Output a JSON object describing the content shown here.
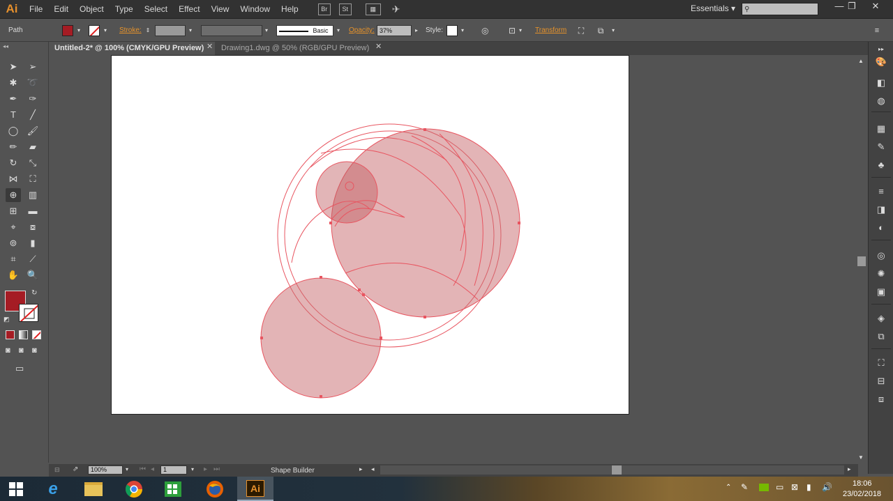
{
  "app": {
    "logo": "Ai",
    "brand_color": "#e6902c"
  },
  "menu": [
    "File",
    "Edit",
    "Object",
    "Type",
    "Select",
    "Effect",
    "View",
    "Window",
    "Help"
  ],
  "menu_boxes": {
    "bridge": "Br",
    "stock": "St"
  },
  "workspace": {
    "label": "Essentials"
  },
  "window_controls": {
    "minimize": "—",
    "restore": "❐",
    "close": "✕"
  },
  "control_bar": {
    "selection_label": "Path",
    "fill_color": "#a51c24",
    "stroke_label": "Stroke:",
    "brush_label": "Basic",
    "opacity_label": "Opacity:",
    "opacity_value": "37%",
    "style_label": "Style:",
    "transform_label": "Transform"
  },
  "tabs": [
    {
      "label": "Untitled-2* @ 100% (CMYK/GPU Preview)",
      "active": true
    },
    {
      "label": "Drawing1.dwg @ 50% (RGB/GPU Preview)",
      "active": false
    }
  ],
  "tools": [
    [
      "selection-tool-icon",
      "direct-selection-tool-icon"
    ],
    [
      "magic-wand-icon",
      "lasso-icon"
    ],
    [
      "pen-tool-icon",
      "curvature-tool-icon"
    ],
    [
      "type-tool-icon",
      "line-segment-tool-icon"
    ],
    [
      "ellipse-tool-icon",
      "paintbrush-tool-icon"
    ],
    [
      "pencil-tool-icon",
      "eraser-tool-icon"
    ],
    [
      "rotate-tool-icon",
      "scale-tool-icon"
    ],
    [
      "width-tool-icon",
      "free-transform-icon"
    ],
    [
      "shape-builder-icon",
      "perspective-grid-icon"
    ],
    [
      "mesh-tool-icon",
      "gradient-tool-icon"
    ],
    [
      "eyedropper-icon",
      "blend-tool-icon"
    ],
    [
      "symbol-sprayer-icon",
      "column-graph-icon"
    ],
    [
      "artboard-tool-icon",
      "slice-tool-icon"
    ],
    [
      "hand-tool-icon",
      "zoom-tool-icon"
    ]
  ],
  "status_bar": {
    "zoom": "100%",
    "artboard_number": "1",
    "current_tool": "Shape Builder"
  },
  "taskbar": {
    "time": "18:06",
    "date": "23/02/2018"
  }
}
